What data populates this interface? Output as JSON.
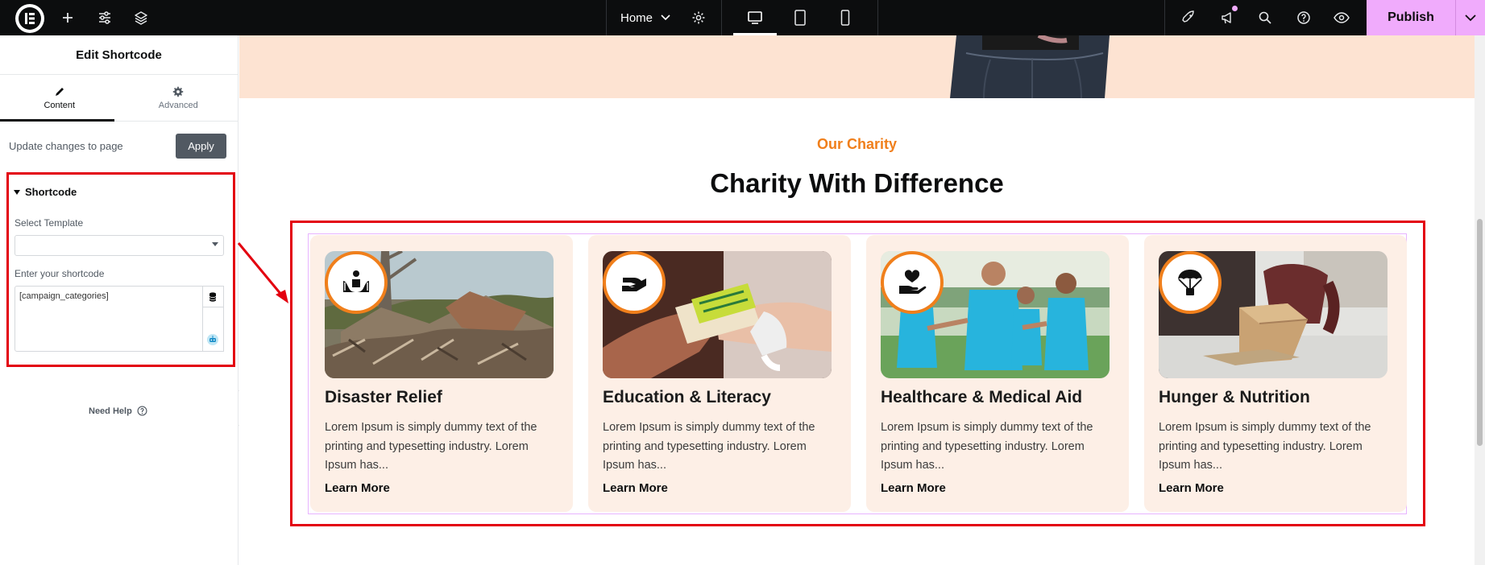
{
  "topbar": {
    "page_selector": "Home",
    "publish_label": "Publish",
    "icons": [
      "elementor-logo-icon",
      "plus-icon",
      "sliders-icon",
      "layers-icon",
      "chevron-down-icon",
      "gear-icon",
      "desktop-icon",
      "tablet-icon",
      "mobile-icon",
      "rocket-icon",
      "megaphone-icon",
      "search-icon",
      "help-icon",
      "eye-icon",
      "chevron-down-icon"
    ]
  },
  "panel": {
    "title": "Edit Shortcode",
    "tabs": [
      {
        "label": "Content",
        "icon": "pencil-icon",
        "active": true
      },
      {
        "label": "Advanced",
        "icon": "gear-icon",
        "active": false
      }
    ],
    "update_text": "Update changes to page",
    "apply_label": "Apply",
    "section_title": "Shortcode",
    "select_template_label": "Select Template",
    "select_template_value": "",
    "shortcode_label": "Enter your shortcode",
    "shortcode_value": "[campaign_categories]",
    "need_help": "Need Help"
  },
  "canvas": {
    "eyebrow": "Our Charity",
    "title": "Charity With Difference",
    "cards": [
      {
        "title": "Disaster Relief",
        "text": "Lorem Ipsum is simply dummy text of the printing and typesetting industry. Lorem Ipsum has...",
        "link": "Learn More",
        "icon": "hands-people-icon"
      },
      {
        "title": "Education & Literacy",
        "text": "Lorem Ipsum is simply dummy text of the printing and typesetting industry. Lorem Ipsum has...",
        "link": "Learn More",
        "icon": "giving-hand-icon"
      },
      {
        "title": "Healthcare & Medical Aid",
        "text": "Lorem Ipsum is simply dummy text of the printing and typesetting industry. Lorem Ipsum has...",
        "link": "Learn More",
        "icon": "heart-hand-icon"
      },
      {
        "title": "Hunger & Nutrition",
        "text": "Lorem Ipsum is simply dummy text of the printing and typesetting industry. Lorem Ipsum has...",
        "link": "Learn More",
        "icon": "parachute-icon"
      }
    ]
  },
  "colors": {
    "accent": "#f07f1b",
    "publish": "#f0abfc",
    "annotation_red": "#e3000f",
    "card_bg": "#fdefe6"
  }
}
